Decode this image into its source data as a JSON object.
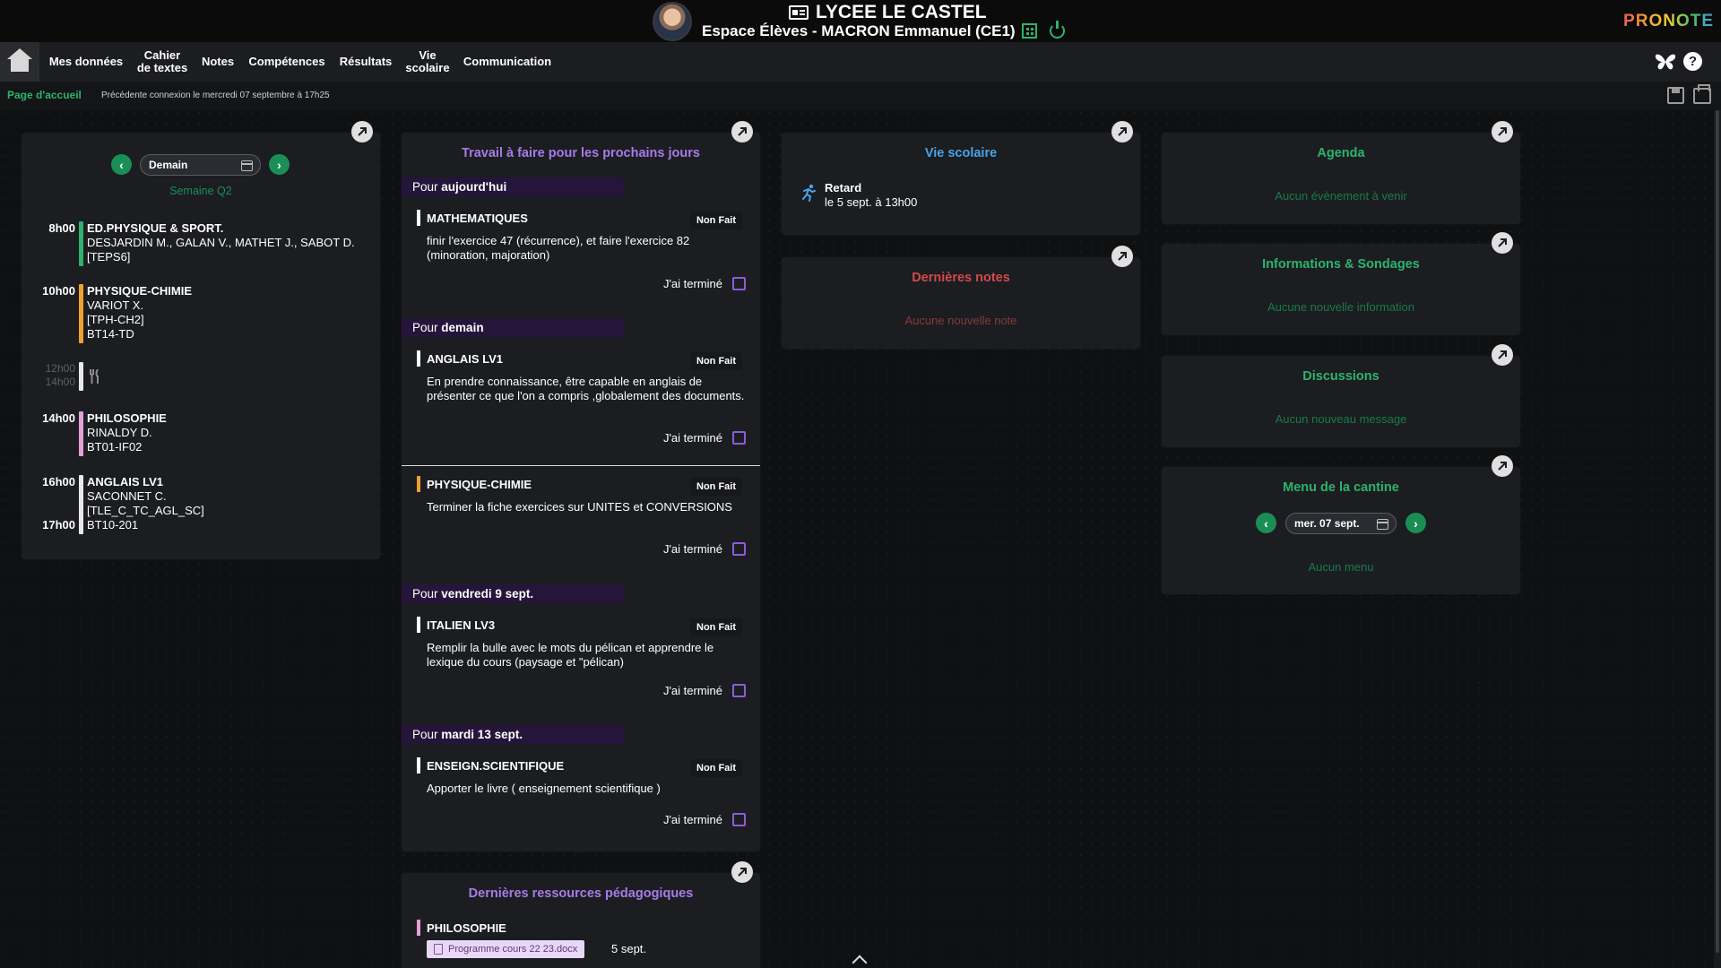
{
  "header": {
    "school": "LYCEE LE CASTEL",
    "space": "Espace Élèves - MACRON Emmanuel (CE1)",
    "brand": "PRONOTE"
  },
  "nav": {
    "items": [
      "Mes données",
      "Cahier\nde textes",
      "Notes",
      "Compétences",
      "Résultats",
      "Vie\nscolaire",
      "Communication"
    ]
  },
  "subbar": {
    "page": "Page d'accueil",
    "last_connection": "Précédente connexion le mercredi 07 septembre à 17h25"
  },
  "schedule": {
    "date": "Demain",
    "week": "Semaine Q2",
    "entries": [
      {
        "time": "8h00",
        "color": "#2db36b",
        "title": "ED.PHYSIQUE & SPORT.",
        "lines": [
          "DESJARDIN M., GALAN V., MATHET J., SABOT D.",
          "[TEPS6]"
        ]
      },
      {
        "time": "10h00",
        "color": "#f0a030",
        "title": "PHYSIQUE-CHIMIE",
        "lines": [
          "VARIOT X.",
          "[TPH-CH2]",
          "BT14-TD"
        ]
      },
      {
        "time": "14h00",
        "color": "#e5a0d8",
        "title": "PHILOSOPHIE",
        "lines": [
          "RINALDY D.",
          "BT01-IF02"
        ]
      },
      {
        "time": "16h00",
        "color": "#e8e8e8",
        "title": "ANGLAIS LV1",
        "lines": [
          "SACONNET C.",
          "[TLE_C_TC_AGL_SC]",
          "BT10-201"
        ]
      }
    ],
    "lunch": {
      "start": "12h00",
      "end": "14h00"
    },
    "end_time": "17h00"
  },
  "homework": {
    "title": "Travail à faire pour les prochains jours",
    "done_label": "J'ai terminé",
    "sections": [
      {
        "prefix": "Pour",
        "when": "aujourd'hui"
      },
      {
        "prefix": "Pour",
        "when": "demain"
      },
      {
        "prefix": "Pour",
        "when": "vendredi 9 sept."
      },
      {
        "prefix": "Pour",
        "when": "mardi 13 sept."
      }
    ],
    "items": [
      {
        "subject": "MATHEMATIQUES",
        "status": "Non Fait",
        "color": "#ffffff",
        "desc": "finir l'exercice 47 (récurrence), et faire l'exercice 82 (minoration, majoration)"
      },
      {
        "subject": "ANGLAIS LV1",
        "status": "Non Fait",
        "color": "#ffffff",
        "desc": "En prendre connaissance, être capable en anglais de présenter ce que l'on a compris ,globalement des documents."
      },
      {
        "subject": "PHYSIQUE-CHIMIE",
        "status": "Non Fait",
        "color": "#f0a030",
        "desc": "Terminer la fiche exercices sur UNITES et CONVERSIONS"
      },
      {
        "subject": "ITALIEN LV3",
        "status": "Non Fait",
        "color": "#ffffff",
        "desc": "Remplir la bulle avec le mots du pélican et apprendre le lexique du cours (paysage et \"pélican)"
      },
      {
        "subject": "ENSEIGN.SCIENTIFIQUE",
        "status": "Non Fait",
        "color": "#ffffff",
        "desc": "Apporter le livre ( enseignement scientifique )"
      }
    ]
  },
  "resources": {
    "title": "Dernières ressources pédagogiques",
    "subject": "PHILOSOPHIE",
    "file": "Programme cours 22 23.docx",
    "date": "5 sept."
  },
  "vie_scolaire": {
    "title": "Vie scolaire",
    "event_label": "Retard",
    "event_date": "le 5 sept. à 13h00"
  },
  "notes": {
    "title": "Dernières notes",
    "empty": "Aucune nouvelle note"
  },
  "agenda": {
    "title": "Agenda",
    "empty": "Aucun évènement à venir"
  },
  "infos": {
    "title": "Informations & Sondages",
    "empty": "Aucune nouvelle information"
  },
  "discussions": {
    "title": "Discussions",
    "empty": "Aucun nouveau message"
  },
  "cantine": {
    "title": "Menu de la cantine",
    "date": "mer. 07 sept.",
    "empty": "Aucun menu"
  },
  "colors": {
    "green": "#2db36b",
    "blue": "#4aa3e8",
    "red": "#d24a4a",
    "purple": "#8c5cd8"
  }
}
